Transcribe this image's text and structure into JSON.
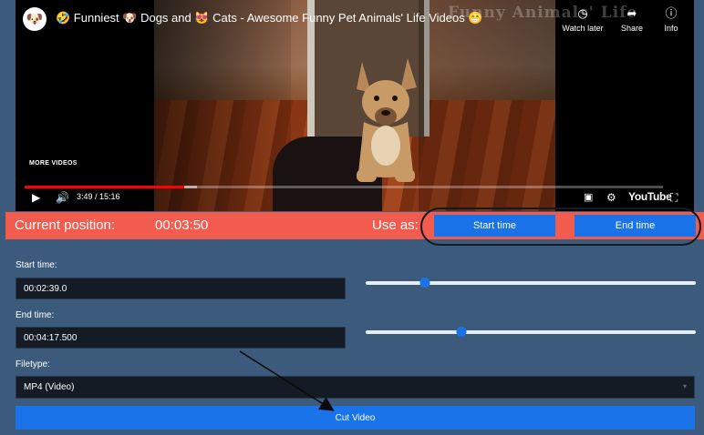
{
  "player": {
    "title": "🤣 Funniest 🐶 Dogs and 😻 Cats - Awesome Funny Pet Animals' Life Videos 😁",
    "watermark": "Funny Animals' Life",
    "actions": [
      {
        "label": "Watch later",
        "icon": "clock-icon"
      },
      {
        "label": "Share",
        "icon": "share-icon"
      },
      {
        "label": "Info",
        "icon": "info-icon"
      }
    ],
    "more_videos": "MORE VIDEOS",
    "time": "3:49 / 15:16",
    "progress": 0.25,
    "buffered": 0.27,
    "logo": "YouTube"
  },
  "position_bar": {
    "label": "Current position:",
    "value": "00:03:50",
    "use_as": "Use as:",
    "start_button": "Start time",
    "end_button": "End time"
  },
  "form": {
    "start_label": "Start time:",
    "start_value": "00:02:39.0",
    "start_slider": 0.18,
    "end_label": "End time:",
    "end_value": "00:04:17.500",
    "end_slider": 0.29,
    "filetype_label": "Filetype:",
    "filetype_value": "MP4 (Video)",
    "cut_button": "Cut Video"
  },
  "colors": {
    "background": "#3c5a7c",
    "accent": "#1a73e8",
    "position_bar": "#f25c4e"
  }
}
